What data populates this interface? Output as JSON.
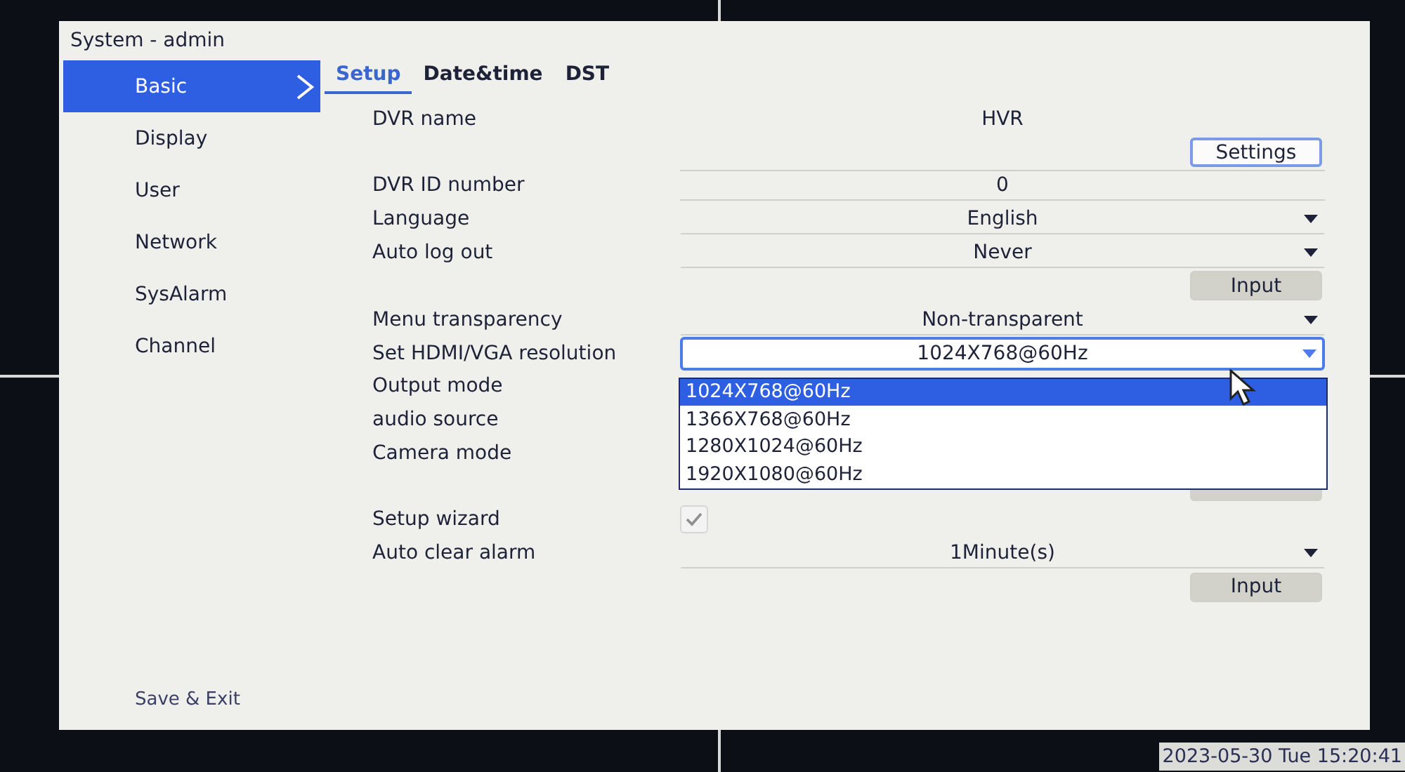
{
  "window": {
    "title": "System - admin"
  },
  "sidebar": {
    "items": [
      {
        "label": "Basic",
        "selected": true
      },
      {
        "label": "Display",
        "selected": false
      },
      {
        "label": "User",
        "selected": false
      },
      {
        "label": "Network",
        "selected": false
      },
      {
        "label": "SysAlarm",
        "selected": false
      },
      {
        "label": "Channel",
        "selected": false
      }
    ],
    "save_exit": "Save & Exit"
  },
  "tabs": [
    {
      "label": "Setup",
      "selected": true
    },
    {
      "label": "Date&time",
      "selected": false
    },
    {
      "label": "DST",
      "selected": false
    }
  ],
  "rows": [
    {
      "kind": "text",
      "label": "DVR name",
      "value": "HVR"
    },
    {
      "kind": "button",
      "label": "Settings",
      "highlighted": true
    },
    {
      "kind": "field",
      "label": "DVR ID number",
      "value": "0"
    },
    {
      "kind": "select",
      "label": "Language",
      "value": "English",
      "focused": false
    },
    {
      "kind": "select",
      "label": "Auto log out",
      "value": "Never",
      "focused": false
    },
    {
      "kind": "button",
      "label": "Input",
      "highlighted": false
    },
    {
      "kind": "select",
      "label": "Menu transparency",
      "value": "Non-transparent",
      "focused": false
    },
    {
      "kind": "select",
      "label": "Set HDMI/VGA resolution",
      "value": "1024X768@60Hz",
      "focused": true,
      "options": [
        {
          "label": "1024X768@60Hz",
          "selected": true
        },
        {
          "label": "1366X768@60Hz",
          "selected": false
        },
        {
          "label": "1280X1024@60Hz",
          "selected": false
        },
        {
          "label": "1920X1080@60Hz",
          "selected": false
        }
      ]
    },
    {
      "kind": "label",
      "label": "Output mode"
    },
    {
      "kind": "label",
      "label": "audio source"
    },
    {
      "kind": "label",
      "label": "Camera mode"
    },
    {
      "kind": "covered"
    },
    {
      "kind": "checkbox",
      "label": "Setup wizard",
      "checked": true
    },
    {
      "kind": "select",
      "label": "Auto clear alarm",
      "value": "1Minute(s)",
      "focused": false
    },
    {
      "kind": "button",
      "label": "Input",
      "highlighted": false
    }
  ],
  "clock": "2023-05-30 Tue 15:20:41"
}
